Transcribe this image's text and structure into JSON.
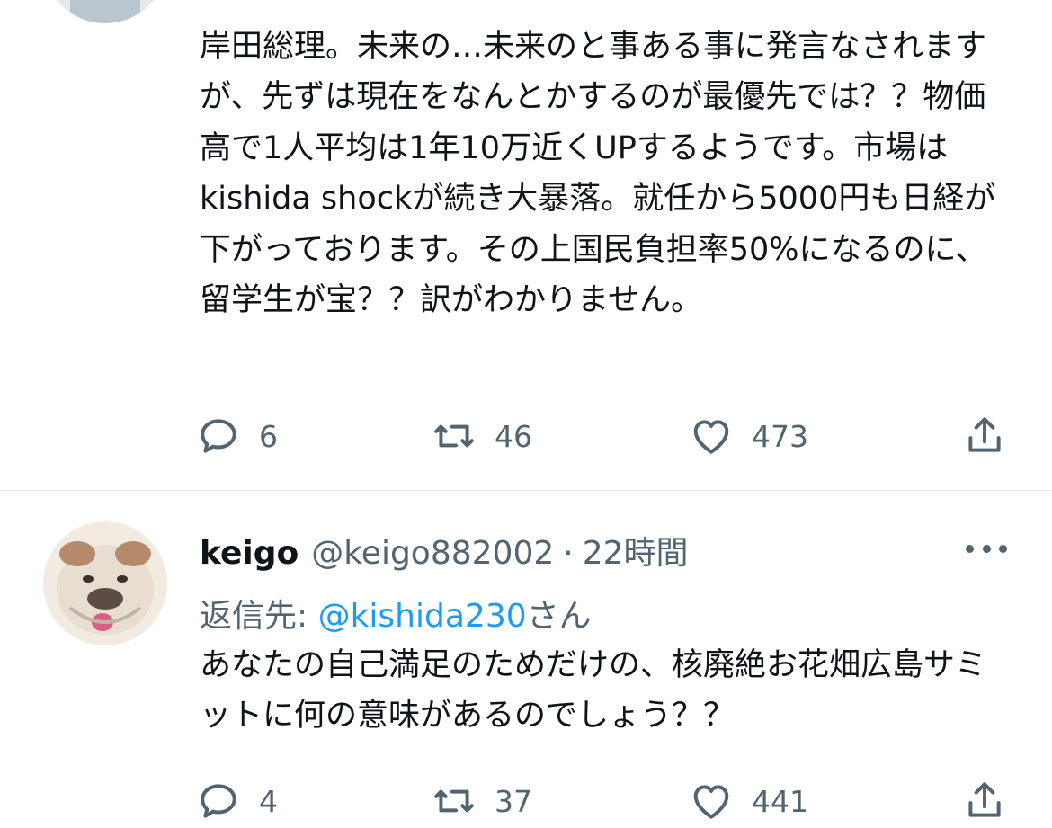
{
  "tweets": [
    {
      "text": "岸田総理。未来の…未来のと事ある事に発言なされますが、先ずは現在をなんとかするのが最優先では？？物価高で1人平均は1年10万近くUPするようです。市場はkishida shockが続き大暴落。就任から5000円も日経が下がっております。その上国民負担率50%になるのに、留学生が宝？？訳がわかりません。",
      "actions": {
        "reply_count": "6",
        "retweet_count": "46",
        "like_count": "473"
      }
    },
    {
      "display_name": "keigo",
      "handle": "@keigo882002",
      "separator": "·",
      "time": "22時間",
      "reply_prefix": "返信先: ",
      "reply_mention": "@kishida230",
      "reply_suffix": "さん",
      "text": "あなたの自己満足のためだけの、核廃絶お花畑広島サミットに何の意味があるのでしょう？？",
      "actions": {
        "reply_count": "4",
        "retweet_count": "37",
        "like_count": "441"
      }
    }
  ],
  "icons": {
    "reply": "reply-icon",
    "retweet": "retweet-icon",
    "like": "heart-icon",
    "share": "share-icon",
    "more": "more-icon"
  },
  "colors": {
    "text": "#0f1419",
    "secondary": "#536471",
    "link": "#1d9bf0",
    "divider": "#e6e9eb"
  }
}
